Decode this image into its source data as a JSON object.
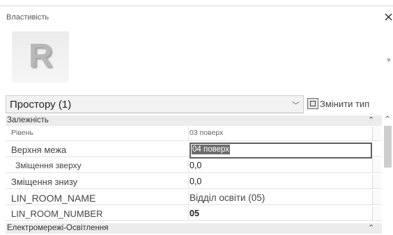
{
  "window": {
    "title": "Властивість",
    "close_glyph": "×"
  },
  "type_selector": {
    "logo_letter": "R",
    "current_type": "Простору (1)",
    "edit_type_label": "Змінити тип"
  },
  "sections": [
    {
      "title": "Залежність",
      "rows": [
        {
          "name": "Рівень",
          "value": "03 поверх"
        },
        {
          "name": "Верхня межа",
          "value": "04 поверх"
        },
        {
          "name": "Зміщення зверху",
          "value": "0,0"
        },
        {
          "name": "Зміщення знизу",
          "value": "0,0"
        },
        {
          "name": "LIN_ROOM_NAME",
          "value": "Відділ освіти (05)"
        },
        {
          "name": "LIN_ROOM_NUMBER",
          "value": "05"
        }
      ]
    },
    {
      "title": "Електромережі-Освітлення",
      "rows": []
    }
  ],
  "icons": {
    "collapse": "chevrons-up-icon",
    "dropdown": "chevron-down-icon",
    "edit_type": "edit-type-icon",
    "close": "close-icon",
    "scroll_up": "scroll-up-icon"
  }
}
